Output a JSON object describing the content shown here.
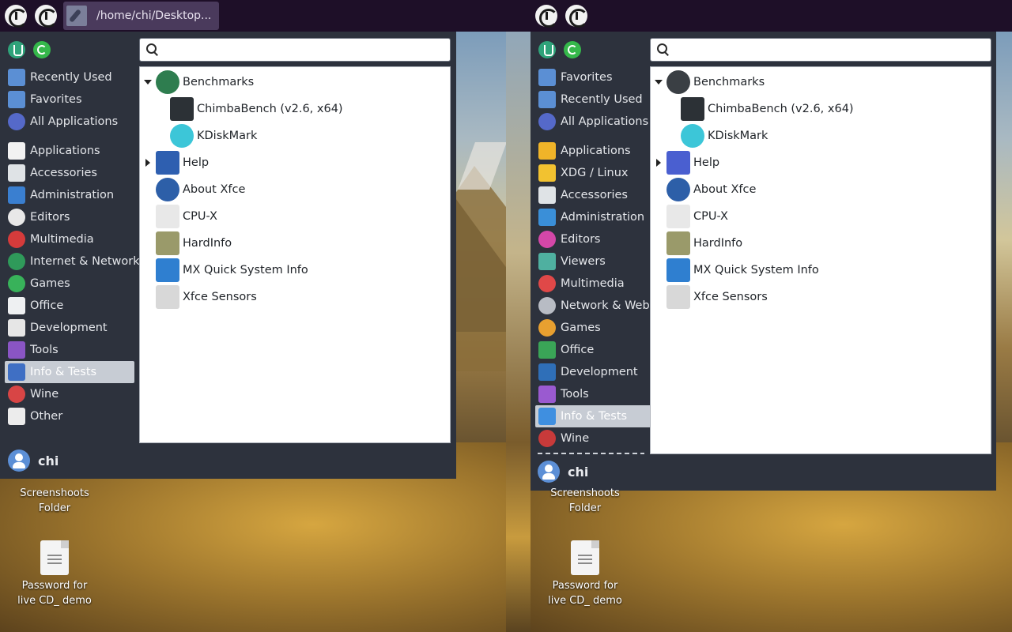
{
  "panel": {
    "task_label": "/home/chi/Desktop..."
  },
  "left_menu": {
    "search_placeholder": "",
    "categories": [
      {
        "label": "Recently Used",
        "icon": "recently-used-folder-icon",
        "color": "#5b8fd4"
      },
      {
        "label": "Favorites",
        "icon": "favorites-folder-icon",
        "color": "#5b8fd4"
      },
      {
        "label": "All Applications",
        "icon": "all-applications-icon",
        "color": "#5569c9"
      },
      {
        "label": "Applications",
        "icon": "applications-grid-icon",
        "color": "#f2f2f2"
      },
      {
        "label": "Accessories",
        "icon": "accessories-icon",
        "color": "#dfe3e6"
      },
      {
        "label": "Administration",
        "icon": "administration-icon",
        "color": "#3a7fd0"
      },
      {
        "label": "Editors",
        "icon": "editors-icon",
        "color": "#e8e8e8"
      },
      {
        "label": "Multimedia",
        "icon": "multimedia-icon",
        "color": "#d53b3b"
      },
      {
        "label": "Internet & Network",
        "icon": "internet-network-icon",
        "color": "#2f9a5a"
      },
      {
        "label": "Games",
        "icon": "games-icon",
        "color": "#38b25a"
      },
      {
        "label": "Office",
        "icon": "office-icon",
        "color": "#eef0f2"
      },
      {
        "label": "Development",
        "icon": "development-icon",
        "color": "#e6e6e6"
      },
      {
        "label": "Tools",
        "icon": "tools-icon",
        "color": "#8a55c4"
      },
      {
        "label": "Info & Tests",
        "icon": "info-tests-icon",
        "color": "#3f6fc4"
      },
      {
        "label": "Wine",
        "icon": "wine-icon",
        "color": "#d84545"
      },
      {
        "label": "Other",
        "icon": "other-icon",
        "color": "#ececec"
      }
    ],
    "apps": [
      {
        "label": "Benchmarks",
        "icon": "benchmarks-gauge-icon",
        "color": "#2e7d4f",
        "arrow": "down"
      },
      {
        "label": "ChimbaBench (v2.6, x64)",
        "icon": "chimbabench-icon",
        "color": "#2c3136"
      },
      {
        "label": "KDiskMark",
        "icon": "kdiskmark-icon",
        "color": "#3cc6d8"
      },
      {
        "label": "Help",
        "icon": "help-icon",
        "color": "#2e5fb0",
        "arrow": "right"
      },
      {
        "label": "About Xfce",
        "icon": "about-xfce-icon",
        "color": "#2d5fa8"
      },
      {
        "label": "CPU-X",
        "icon": "cpu-x-icon",
        "color": "#e8e8e8"
      },
      {
        "label": "HardInfo",
        "icon": "hardinfo-icon",
        "color": "#9a9a6a"
      },
      {
        "label": "MX Quick System Info",
        "icon": "mx-quick-system-info-icon",
        "color": "#2f7fd0"
      },
      {
        "label": "Xfce Sensors",
        "icon": "xfce-sensors-icon",
        "color": "#d8d8d8"
      }
    ],
    "user": "chi"
  },
  "right_menu": {
    "search_placeholder": "",
    "categories": [
      {
        "label": "Favorites",
        "icon": "favorites-folder-icon",
        "color": "#5b8fd4"
      },
      {
        "label": "Recently Used",
        "icon": "recently-used-folder-icon",
        "color": "#5b8fd4"
      },
      {
        "label": "All Applications",
        "icon": "all-applications-icon",
        "color": "#5569c9"
      },
      {
        "label": "Applications",
        "icon": "applications-grid-icon",
        "color": "#f0b429"
      },
      {
        "label": "XDG / Linux",
        "icon": "xdg-linux-tux-icon",
        "color": "#f2c230"
      },
      {
        "label": "Accessories",
        "icon": "accessories-icon",
        "color": "#dfe3e6"
      },
      {
        "label": "Administration",
        "icon": "administration-icon",
        "color": "#3a8fd8"
      },
      {
        "label": "Editors",
        "icon": "editors-icon",
        "color": "#d447a8"
      },
      {
        "label": "Viewers",
        "icon": "viewers-icon",
        "color": "#4fb0a0"
      },
      {
        "label": "Multimedia",
        "icon": "multimedia-icon",
        "color": "#e04848"
      },
      {
        "label": "Network & Web",
        "icon": "network-web-icon",
        "color": "#b8bcc4"
      },
      {
        "label": "Games",
        "icon": "games-icon",
        "color": "#e8a030"
      },
      {
        "label": "Office",
        "icon": "office-icon",
        "color": "#3aa557"
      },
      {
        "label": "Development",
        "icon": "development-icon",
        "color": "#2f6fb8"
      },
      {
        "label": "Tools",
        "icon": "tools-icon",
        "color": "#9a5ad0"
      },
      {
        "label": "Info & Tests",
        "icon": "info-tests-icon",
        "color": "#3f8fe0"
      },
      {
        "label": "Wine",
        "icon": "wine-icon",
        "color": "#c83a3a"
      }
    ],
    "apps": [
      {
        "label": "Benchmarks",
        "icon": "benchmarks-gauge-icon",
        "color": "#3a3f44",
        "arrow": "down"
      },
      {
        "label": "ChimbaBench (v2.6, x64)",
        "icon": "chimbabench-icon",
        "color": "#2c3136"
      },
      {
        "label": "KDiskMark",
        "icon": "kdiskmark-icon",
        "color": "#3cc6d8"
      },
      {
        "label": "Help",
        "icon": "help-icon",
        "color": "#4a5fd0",
        "arrow": "right"
      },
      {
        "label": "About Xfce",
        "icon": "about-xfce-icon",
        "color": "#2d5fa8"
      },
      {
        "label": "CPU-X",
        "icon": "cpu-x-icon",
        "color": "#e8e8e8"
      },
      {
        "label": "HardInfo",
        "icon": "hardinfo-icon",
        "color": "#9a9a6a"
      },
      {
        "label": "MX Quick System Info",
        "icon": "mx-quick-system-info-icon",
        "color": "#2f7fd0"
      },
      {
        "label": "Xfce Sensors",
        "icon": "xfce-sensors-icon",
        "color": "#d8d8d8"
      }
    ],
    "user": "chi"
  },
  "desktop": {
    "folder_label": "Screenshoots\nFolder",
    "folder_line1": "Screenshoots",
    "folder_line2": "Folder",
    "file_line1": "Password for",
    "file_line2": "live CD_ demo"
  },
  "colors": {
    "panel_bg": "#1e0f28",
    "menu_bg": "#2d323d",
    "selected_bg": "#c7ccd4"
  }
}
